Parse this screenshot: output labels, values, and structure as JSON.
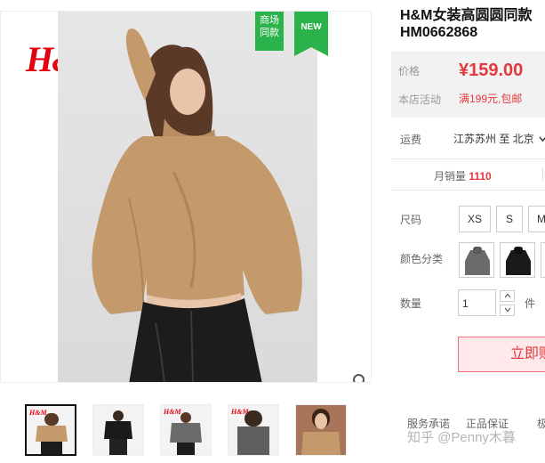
{
  "product": {
    "title_line1": "H&M女装高圆圆同款 ",
    "title_line2": "HM0662868",
    "brand_logo": "H&M",
    "badge_mall": "商场\n同款",
    "badge_new": "NEW"
  },
  "price_box": {
    "price_label": "价格",
    "price": "¥159.00",
    "promo_label": "本店活动",
    "promo": "满199元,包邮"
  },
  "shipping": {
    "label": "运费",
    "value": "江苏苏州 至 北京"
  },
  "sales": {
    "label": "月销量",
    "count": "1110"
  },
  "options": {
    "size_label": "尺码",
    "sizes": [
      "XS",
      "S",
      "M"
    ],
    "color_label": "颜色分类",
    "colors": [
      "#6b6b6b",
      "#1a1a1a",
      "#c79a6a"
    ],
    "qty_label": "数量",
    "qty_value": "1",
    "unit": "件"
  },
  "actions": {
    "buy_label": "立即购买"
  },
  "services": {
    "label": "服务承诺",
    "items": [
      "正品保证",
      "极"
    ]
  },
  "watermark": "知乎 @Penny木暮",
  "icons": {
    "zoom": "magnifier-icon",
    "stepper_up": "chevron-up-icon",
    "stepper_down": "chevron-down-icon",
    "shipping_dropdown": "chevron-down-icon"
  },
  "colors": {
    "accent_red": "#e4393c",
    "badge_green": "#2bb34b",
    "brand_red": "#e50010"
  }
}
